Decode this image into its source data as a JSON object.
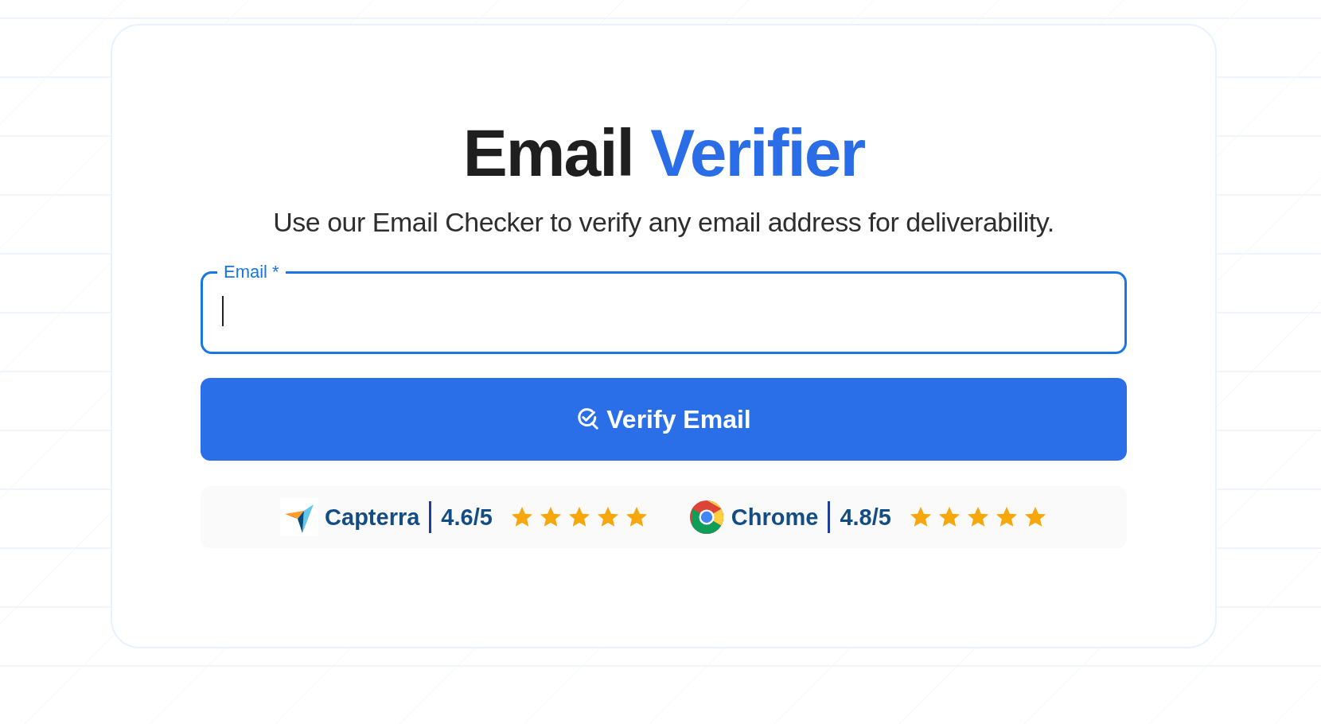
{
  "title": {
    "plain": "Email",
    "accent": "Verifier"
  },
  "subtitle": "Use our Email Checker to verify any email address for deliverability.",
  "email_field": {
    "label": "Email *",
    "focused": true
  },
  "verify_button": {
    "label": "Verify Email"
  },
  "ratings": [
    {
      "kind": "capterra",
      "name": "Capterra",
      "score": "4.6/5",
      "stars": 5
    },
    {
      "kind": "chrome",
      "name": "Chrome",
      "score": "4.8/5",
      "stars": 5
    }
  ]
}
